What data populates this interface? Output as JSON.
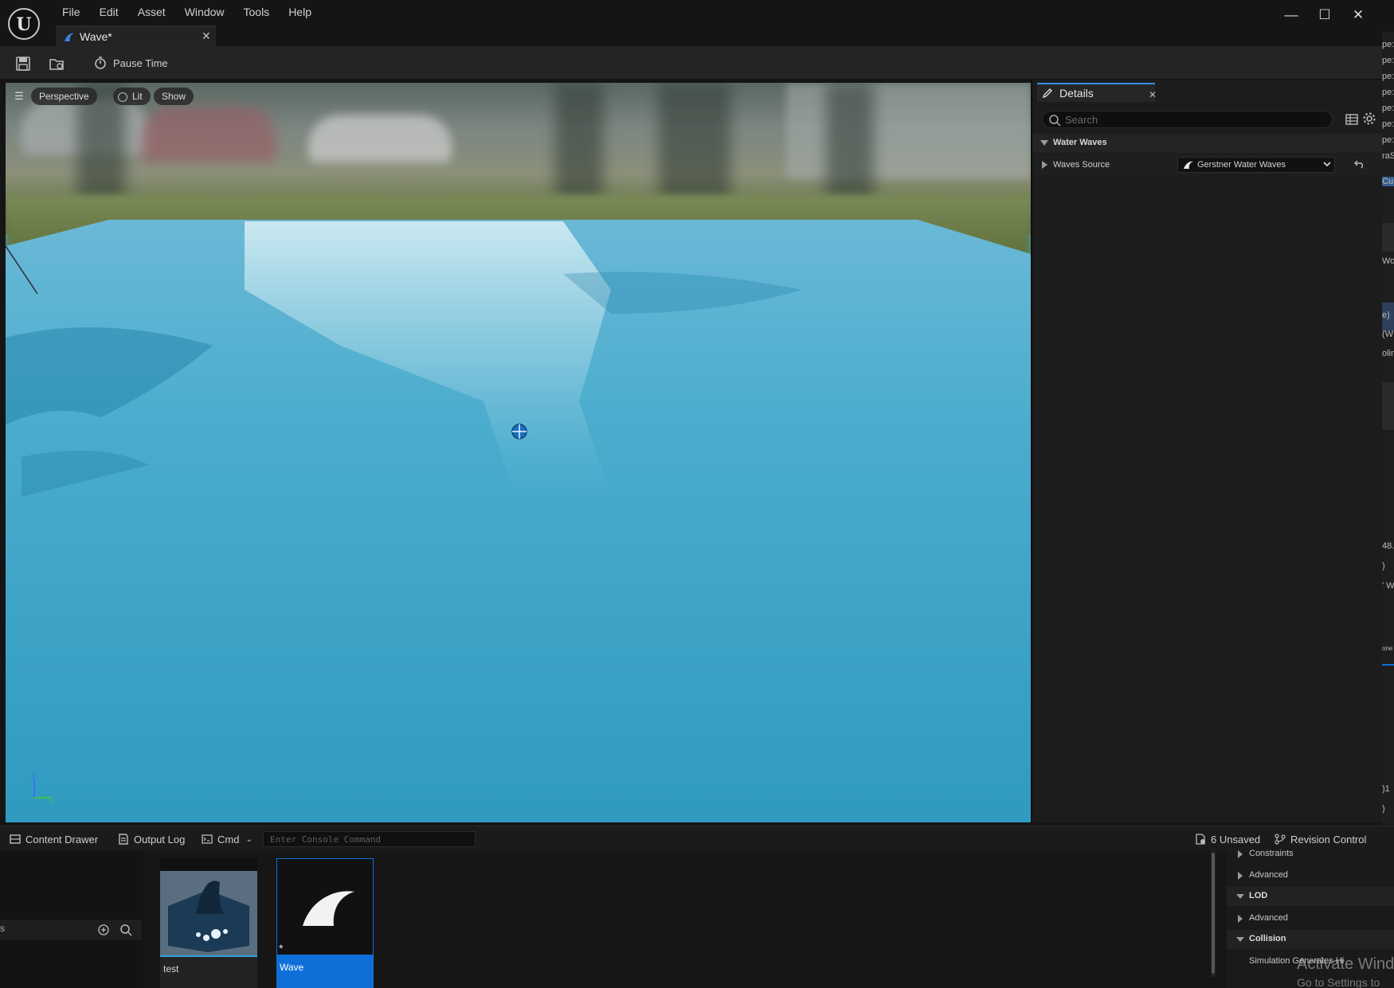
{
  "app": {
    "icon": "unreal-logo-icon"
  },
  "menu": [
    "File",
    "Edit",
    "Asset",
    "Window",
    "Tools",
    "Help"
  ],
  "document_tab": {
    "label": "Wave*",
    "icon": "wave-asset-icon"
  },
  "toolbar": {
    "pause_label": "Pause Time"
  },
  "viewport": {
    "mode_label": "Perspective",
    "lit_label": "Lit",
    "show_label": "Show"
  },
  "details": {
    "tab_label": "Details",
    "search_placeholder": "Search",
    "category": "Water Waves",
    "property_label": "Waves Source",
    "property_value": "Gerstner Water Waves"
  },
  "right_strip": {
    "texts": [
      "pe:",
      "pe:",
      "pe:",
      "pe:",
      "pe:",
      "pe:",
      "pe:",
      "raS",
      "Cu",
      "Wo",
      "e)",
      "(W",
      "olin",
      "48.",
      ")",
      "' W",
      "one",
      ")1",
      ")"
    ]
  },
  "statusbar": {
    "content_drawer": "Content Drawer",
    "output_log": "Output Log",
    "cmd": "Cmd",
    "console_placeholder": "Enter Console Command",
    "unsaved": "6 Unsaved",
    "revision_control": "Revision Control"
  },
  "drawer": {
    "filter_text": "s",
    "assets": [
      {
        "name": "test",
        "selected": false
      },
      {
        "name": "Wave",
        "selected": true,
        "modified": true
      }
    ],
    "properties": [
      {
        "label": "Constraints",
        "type": "sub"
      },
      {
        "label": "Advanced",
        "type": "sub"
      },
      {
        "label": "LOD",
        "type": "category"
      },
      {
        "label": "Advanced",
        "type": "sub"
      },
      {
        "label": "Collision",
        "type": "category"
      },
      {
        "label": "Simulation Generates Hi",
        "type": "prop"
      }
    ],
    "watermark_line1": "Activate Wind",
    "watermark_line2": "Go to Settings to"
  },
  "colors": {
    "accent": "#0e6fd8",
    "water": "#3a9ec0",
    "panel": "#1c1c1c"
  }
}
